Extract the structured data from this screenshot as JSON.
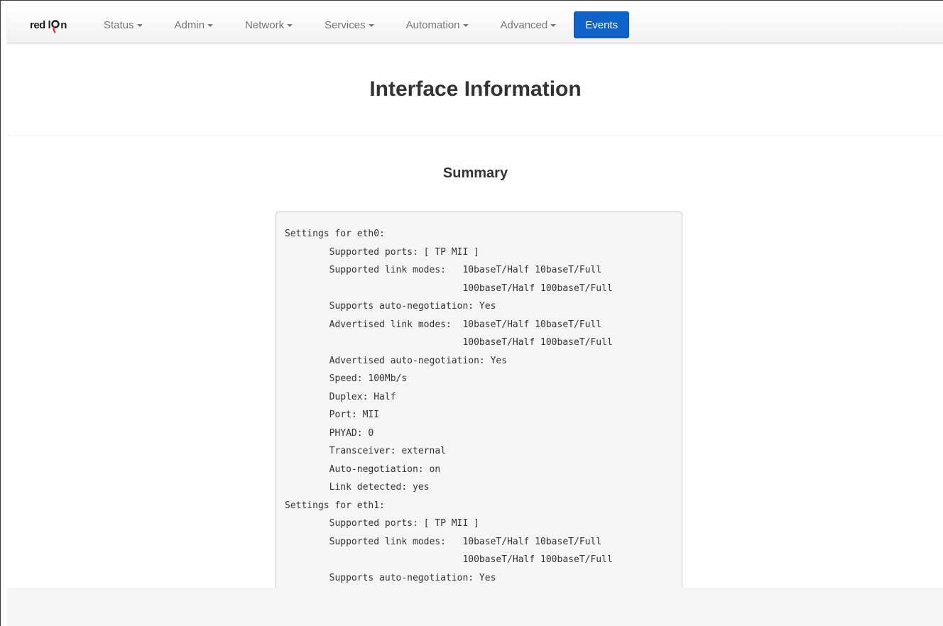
{
  "brand": {
    "text_left": "red l",
    "text_right": "n",
    "logo_accent_color": "#d7262b"
  },
  "nav": {
    "items": [
      {
        "label": "Status"
      },
      {
        "label": "Admin"
      },
      {
        "label": "Network"
      },
      {
        "label": "Services"
      },
      {
        "label": "Automation"
      },
      {
        "label": "Advanced"
      }
    ],
    "events_label": "Events",
    "events_color": "#0d63c8"
  },
  "header": {
    "title": "Interface Information"
  },
  "summary": {
    "title": "Summary",
    "output": "Settings for eth0:\n        Supported ports: [ TP MII ]\n        Supported link modes:   10baseT/Half 10baseT/Full\n                                100baseT/Half 100baseT/Full\n        Supports auto-negotiation: Yes\n        Advertised link modes:  10baseT/Half 10baseT/Full\n                                100baseT/Half 100baseT/Full\n        Advertised auto-negotiation: Yes\n        Speed: 100Mb/s\n        Duplex: Half\n        Port: MII\n        PHYAD: 0\n        Transceiver: external\n        Auto-negotiation: on\n        Link detected: yes\nSettings for eth1:\n        Supported ports: [ TP MII ]\n        Supported link modes:   10baseT/Half 10baseT/Full\n                                100baseT/Half 100baseT/Full\n        Supports auto-negotiation: Yes"
  }
}
